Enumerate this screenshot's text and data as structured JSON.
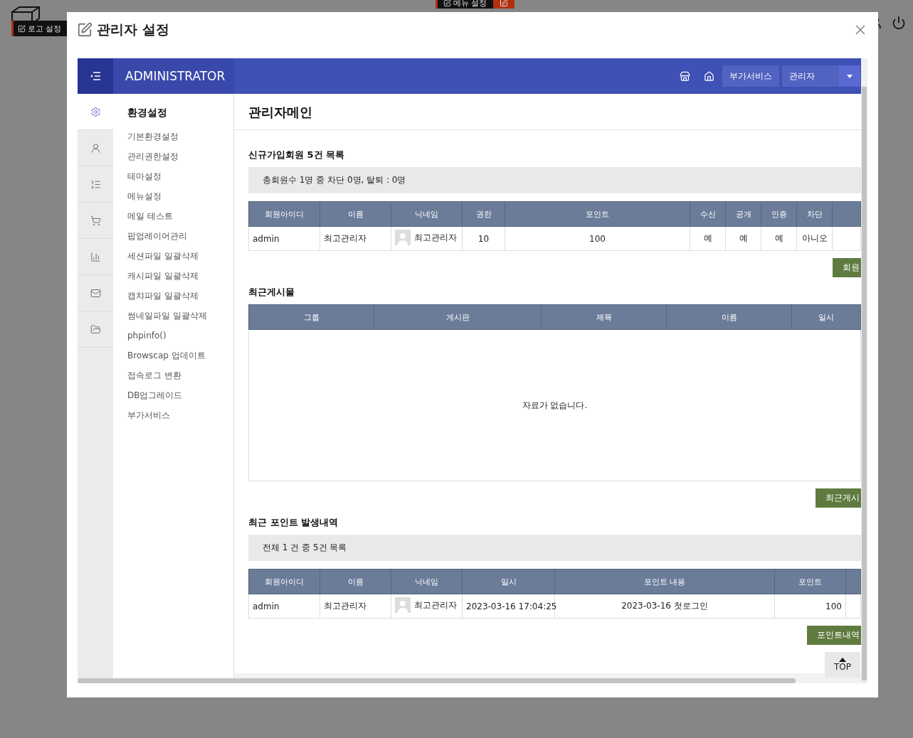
{
  "background": {
    "logo_button": "로고 설정",
    "menu_button": "메뉴 설정"
  },
  "dialog": {
    "title": "관리자 설정"
  },
  "admin": {
    "brand": "ADMINISTRATOR",
    "header_buttons": [
      "부가서비스",
      "관리자"
    ],
    "side_icons": [
      {
        "kind": "gear",
        "selected": true
      },
      {
        "kind": "user",
        "selected": false
      },
      {
        "kind": "list",
        "selected": false
      },
      {
        "kind": "cart",
        "selected": false
      },
      {
        "kind": "chart",
        "selected": false
      },
      {
        "kind": "mail",
        "selected": false
      },
      {
        "kind": "folder",
        "selected": false
      }
    ],
    "menu_title": "환경설정",
    "menu_items": [
      "기본환경설정",
      "관리권한설정",
      "테마설정",
      "메뉴설정",
      "메일 테스트",
      "팝업레이어관리",
      "세션파일 일괄삭제",
      "캐시파일 일괄삭제",
      "캡챠파일 일괄삭제",
      "썸네일파일 일괄삭제",
      "phpinfo()",
      "Browscap 업데이트",
      "접속로그 변환",
      "DB업그레이드",
      "부가서비스"
    ],
    "page_title": "관리자메인",
    "sections": [
      {
        "title": "신규가입회원 5건 목록",
        "summary": "총회원수 1명 중 차단 0명, 탈퇴 : 0명",
        "columns": [
          {
            "label": "회원아이디",
            "kind": "left"
          },
          {
            "label": "이름",
            "kind": "left"
          },
          {
            "label": "닉네임",
            "kind": "nickname"
          },
          {
            "label": "권한",
            "kind": "center"
          },
          {
            "label": "포인트",
            "kind": "center"
          },
          {
            "label": "수신",
            "kind": "center"
          },
          {
            "label": "공개",
            "kind": "center"
          },
          {
            "label": "인증",
            "kind": "center"
          },
          {
            "label": "차단",
            "kind": "center"
          },
          {
            "kind": "center"
          }
        ],
        "rows": [
          [
            "admin",
            "최고관리자",
            "최고관리자",
            "10",
            "100",
            "예",
            "예",
            "예",
            "아니오"
          ]
        ],
        "button": "회원"
      },
      {
        "title": "최근게시물",
        "columns": [
          {
            "label": "그룹"
          },
          {
            "label": "게시판"
          },
          {
            "label": "제목"
          },
          {
            "label": "이름"
          },
          {
            "label": "일시"
          }
        ],
        "empty": "자료가 없습니다.",
        "button": "최근게시"
      },
      {
        "title": "최근 포인트 발생내역",
        "summary": "전체 1 건 중 5건 목록",
        "columns": [
          {
            "label": "회원아이디",
            "kind": "left"
          },
          {
            "label": "이름",
            "kind": "left"
          },
          {
            "label": "닉네임",
            "kind": "nickname"
          },
          {
            "label": "일시",
            "kind": "center"
          },
          {
            "label": "포인트 내용",
            "kind": "center"
          },
          {
            "label": "포인트",
            "kind": "right"
          },
          {
            "kind": "center"
          }
        ],
        "rows": [
          [
            "admin",
            "최고관리자",
            "최고관리자",
            "2023-03-16 17:04:25",
            "2023-03-16 첫로그인",
            "100"
          ]
        ],
        "button": "포인트내역"
      }
    ],
    "top_button": "TOP"
  }
}
